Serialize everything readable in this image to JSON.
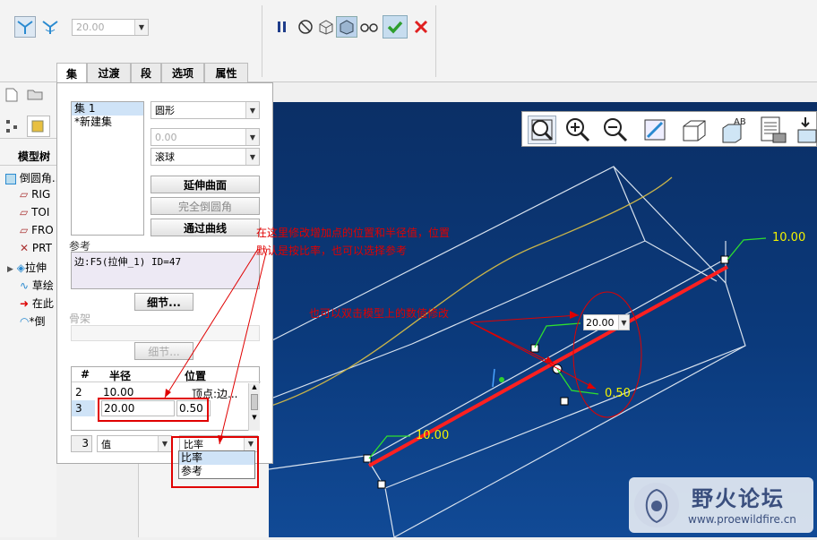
{
  "dashboard": {
    "value_combo": "20.00",
    "icons": [
      "set-mode-icon",
      "transition-mode-icon",
      "pause-icon",
      "no-preview-icon",
      "verify-icon",
      "preview-icon",
      "glasses-icon",
      "confirm-check-icon",
      "cancel-x-icon"
    ]
  },
  "tabs": [
    {
      "label": "集",
      "active": true
    },
    {
      "label": "过渡",
      "active": false
    },
    {
      "label": "段",
      "active": false
    },
    {
      "label": "选项",
      "active": false
    },
    {
      "label": "属性",
      "active": false
    }
  ],
  "sets": [
    "集 1",
    "*新建集"
  ],
  "panel": {
    "shape_select": "圆形",
    "disabled_value": "0.00",
    "method_select": "滚球",
    "btn_extend": "延伸曲面",
    "btn_full": "完全倒圆角",
    "btn_through": "通过曲线",
    "ref_label": "参考",
    "ref_value": "边:F5(拉伸_1) ID=47",
    "detail_btn": "细节...",
    "skeleton_label": "骨架",
    "detail_btn2": "细节..."
  },
  "radius_table": {
    "headers": [
      "#",
      "半径",
      "位置"
    ],
    "rows": [
      {
        "num": "2",
        "radius": "10.00",
        "pos": "顶点:边..."
      },
      {
        "num": "3",
        "radius": "20.00",
        "pos": "0.50"
      }
    ]
  },
  "bottom_row": {
    "num": "3",
    "value_select": "值",
    "ratio_select": "比率"
  },
  "dropdown_options": [
    "比率",
    "参考"
  ],
  "left_nav": {
    "title": "模型树",
    "items": [
      "倒圆角...",
      "RIG",
      "TOI",
      "FRO",
      "PRT",
      "拉伸",
      "草绘",
      "在此",
      "*倒"
    ]
  },
  "annotations": {
    "note1_line1": "在这里修改增加点的位置和半径值，位置",
    "note1_line2": "默认是按比率，也可以选择参考",
    "note2": "也可以双击模型上的数值修改"
  },
  "model_labels": {
    "top": "10.00",
    "bottom": "10.00",
    "middle": "20.00",
    "ratio": "0.50"
  },
  "watermark": {
    "title": "野火论坛",
    "url": "www.proewildfire.cn"
  },
  "colors": {
    "viewport": "#0b3a7c",
    "edge_red": "#ff2020",
    "label_yellow": "#f2f200",
    "annotation_red": "#e00000",
    "confirm_green": "#2e9e2e",
    "cancel_red": "#e02020"
  }
}
